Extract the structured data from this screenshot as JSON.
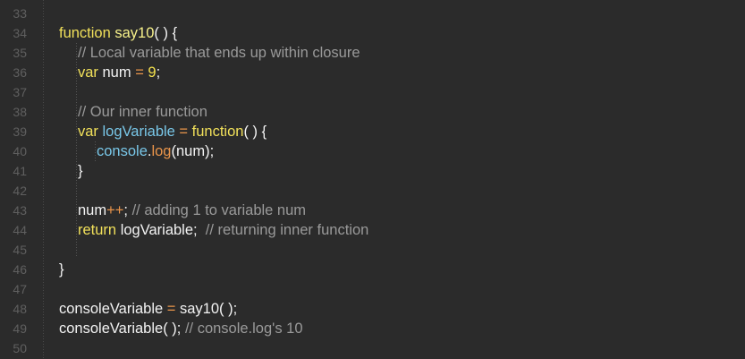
{
  "editor": {
    "line_numbers": [
      "33",
      "34",
      "35",
      "36",
      "37",
      "38",
      "39",
      "40",
      "41",
      "42",
      "43",
      "44",
      "45",
      "46",
      "47",
      "48",
      "49",
      "50"
    ],
    "lines": {
      "l34": {
        "kw": "function",
        "name": " say10",
        "rest": "( ) {"
      },
      "l35": {
        "comment": "// Local variable that ends up within closure"
      },
      "l36": {
        "kw": "var",
        "name": " num",
        "op": " = ",
        "num": "9",
        "rest": ";"
      },
      "l38": {
        "comment": "// Our inner function"
      },
      "l39": {
        "kw": "var",
        "name": " logVariable",
        "op": " = ",
        "fn": "function",
        "rest": "( ) {"
      },
      "l40": {
        "name": "console",
        "dot": ".",
        "method": "log",
        "rest": "(num);"
      },
      "l41": {
        "rest": "}"
      },
      "l43": {
        "name": "num",
        "op": "++",
        "rest": "; ",
        "comment": "// adding 1 to variable num"
      },
      "l44": {
        "kw": "return",
        "rest": " logVariable;  ",
        "comment": "// returning inner function"
      },
      "l46": {
        "rest": "}"
      },
      "l48": {
        "name": "consoleVariable",
        "op": " = ",
        "rest": "say10( );"
      },
      "l49": {
        "name": "consoleVariable",
        "rest": "( ); ",
        "comment": "// console.log's 10"
      }
    }
  }
}
